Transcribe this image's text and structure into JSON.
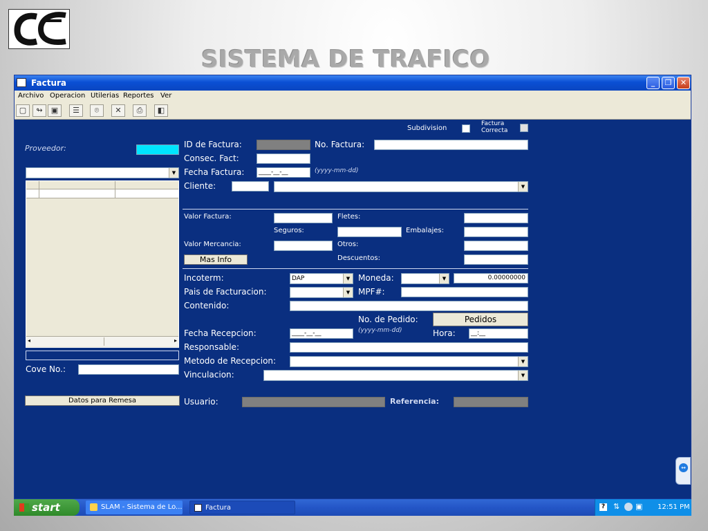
{
  "slide": {
    "title": "SISTEMA DE TRAFICO",
    "logo_icon": "oc-logo-icon"
  },
  "window": {
    "title": "Factura",
    "min": "_",
    "max": "❐",
    "close": "✕"
  },
  "menu": [
    "Archivo",
    "Operacion",
    "Utilerias",
    "Reportes",
    "Ver"
  ],
  "toolbar": {
    "icons": [
      "new-icon",
      "arrow-icon",
      "save-icon",
      "list-icon",
      "binoculars-icon",
      "delete-icon",
      "print-icon",
      "exit-icon"
    ]
  },
  "form": {
    "subdivision": "Subdivision",
    "factura_correcta": "Factura Correcta",
    "proveedor": "Proveedor:",
    "id_factura": "ID de Factura:",
    "no_factura": "No. Factura:",
    "consec_fact": "Consec. Fact:",
    "fecha_factura": "Fecha Factura:",
    "fecha_factura_val": "____-__-__",
    "fecha_fmt": "(yyyy-mm-dd)",
    "cliente": "Cliente:",
    "valor_factura": "Valor Factura:",
    "fletes": "Fletes:",
    "seguros": "Seguros:",
    "embalajes": "Embalajes:",
    "valor_mercancia": "Valor Mercancia:",
    "otros": "Otros:",
    "mas_info": "Mas Info",
    "descuentos": "Descuentos:",
    "incoterm": "Incoterm:",
    "incoterm_val": "DAP",
    "moneda": "Moneda:",
    "moneda_val": "0.00000000",
    "pais": "Pais de Facturacion:",
    "mpf": "MPF#:",
    "contenido": "Contenido:",
    "no_pedido": "No.  de Pedido:",
    "pedidos": "Pedidos",
    "fecha_recepcion": "Fecha Recepcion:",
    "fecha_recepcion_val": "____-__-__",
    "hora": "Hora:",
    "hora_val": "__:__",
    "responsable": "Responsable:",
    "metodo": "Metodo de Recepcion:",
    "vinculacion": "Vinculacion:",
    "cove": "Cove No.:",
    "datos_remesa": "Datos para Remesa",
    "usuario": "Usuario:",
    "referencia": "Referencia:"
  },
  "taskbar": {
    "start": "start",
    "task1": "SLAM - Sistema de Lo...",
    "task2": "Factura",
    "time": "12:51 PM"
  }
}
